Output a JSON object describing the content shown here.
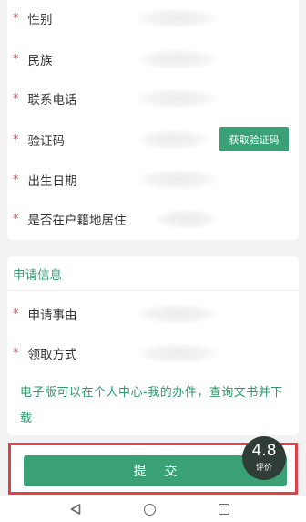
{
  "personal_fields": [
    {
      "label": "性别",
      "required_mark": "*"
    },
    {
      "label": "民族",
      "required_mark": "*"
    },
    {
      "label": "联系电话",
      "required_mark": "*"
    },
    {
      "label": "验证码",
      "required_mark": "*"
    },
    {
      "label": "出生日期",
      "required_mark": "*"
    },
    {
      "label": "是否在户籍地居住",
      "required_mark": "*"
    }
  ],
  "get_code_button": "获取验证码",
  "application_section": {
    "title": "申请信息",
    "fields": [
      {
        "label": "申请事由",
        "required_mark": "*"
      },
      {
        "label": "领取方式",
        "required_mark": "*"
      }
    ],
    "notice": "电子版可以在个人中心-我的办件，查询文书并下载"
  },
  "submit_button": "提交",
  "rating": {
    "score": "4.8",
    "label": "评价"
  },
  "colors": {
    "accent": "#3aa076",
    "required": "#e0404a",
    "highlight_border": "#e0404a"
  },
  "nav_icons": [
    "back-triangle-icon",
    "home-circle-icon",
    "recent-square-icon"
  ]
}
